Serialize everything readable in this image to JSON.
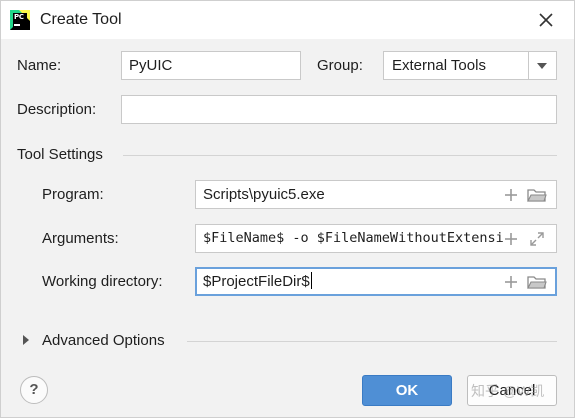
{
  "window": {
    "title": "Create Tool",
    "app_icon_text": "PC"
  },
  "form": {
    "name_label": "Name:",
    "name_value": "PyUIC",
    "group_label": "Group:",
    "group_value": "External Tools",
    "description_label": "Description:",
    "description_value": ""
  },
  "tool_settings": {
    "title": "Tool Settings",
    "program_label": "Program:",
    "program_value": "Scripts\\pyuic5.exe",
    "arguments_label": "Arguments:",
    "arguments_value": "$FileName$ -o $FileNameWithoutExtensi",
    "working_dir_label": "Working directory:",
    "working_dir_value": "$ProjectFileDir$"
  },
  "advanced": {
    "label": "Advanced Options"
  },
  "footer": {
    "help_label": "?",
    "ok_label": "OK",
    "cancel_label": "Cancel",
    "watermark": "知乎 @W凯"
  },
  "colors": {
    "accent": "#4f8fd5",
    "focus_border": "#6aa1dc",
    "background": "#f2f2f2"
  }
}
